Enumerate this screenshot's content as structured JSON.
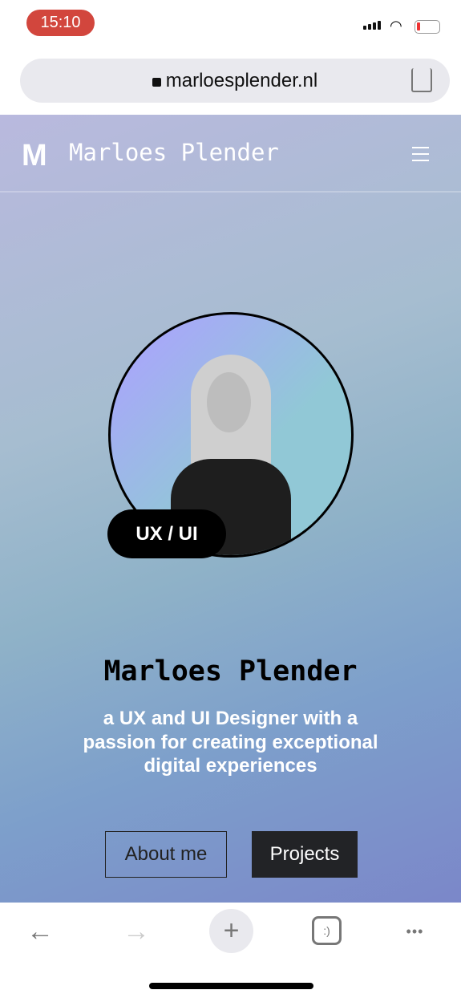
{
  "status": {
    "time": "15:10",
    "time_color": "#d2463d"
  },
  "browser": {
    "url": "marloesplender.nl",
    "tabs_label": ":)"
  },
  "nav": {
    "logo": "M",
    "brand": "Marloes Plender"
  },
  "hero": {
    "badge": "UX / UI",
    "title": "Marloes Plender",
    "subtitle": "a UX and UI Designer with a passion for creating exceptional digital experiences",
    "about_button": "About me",
    "projects_button": "Projects"
  },
  "toolbar": {
    "back": "←",
    "forward": "→",
    "new_tab": "+",
    "more": "•••"
  }
}
